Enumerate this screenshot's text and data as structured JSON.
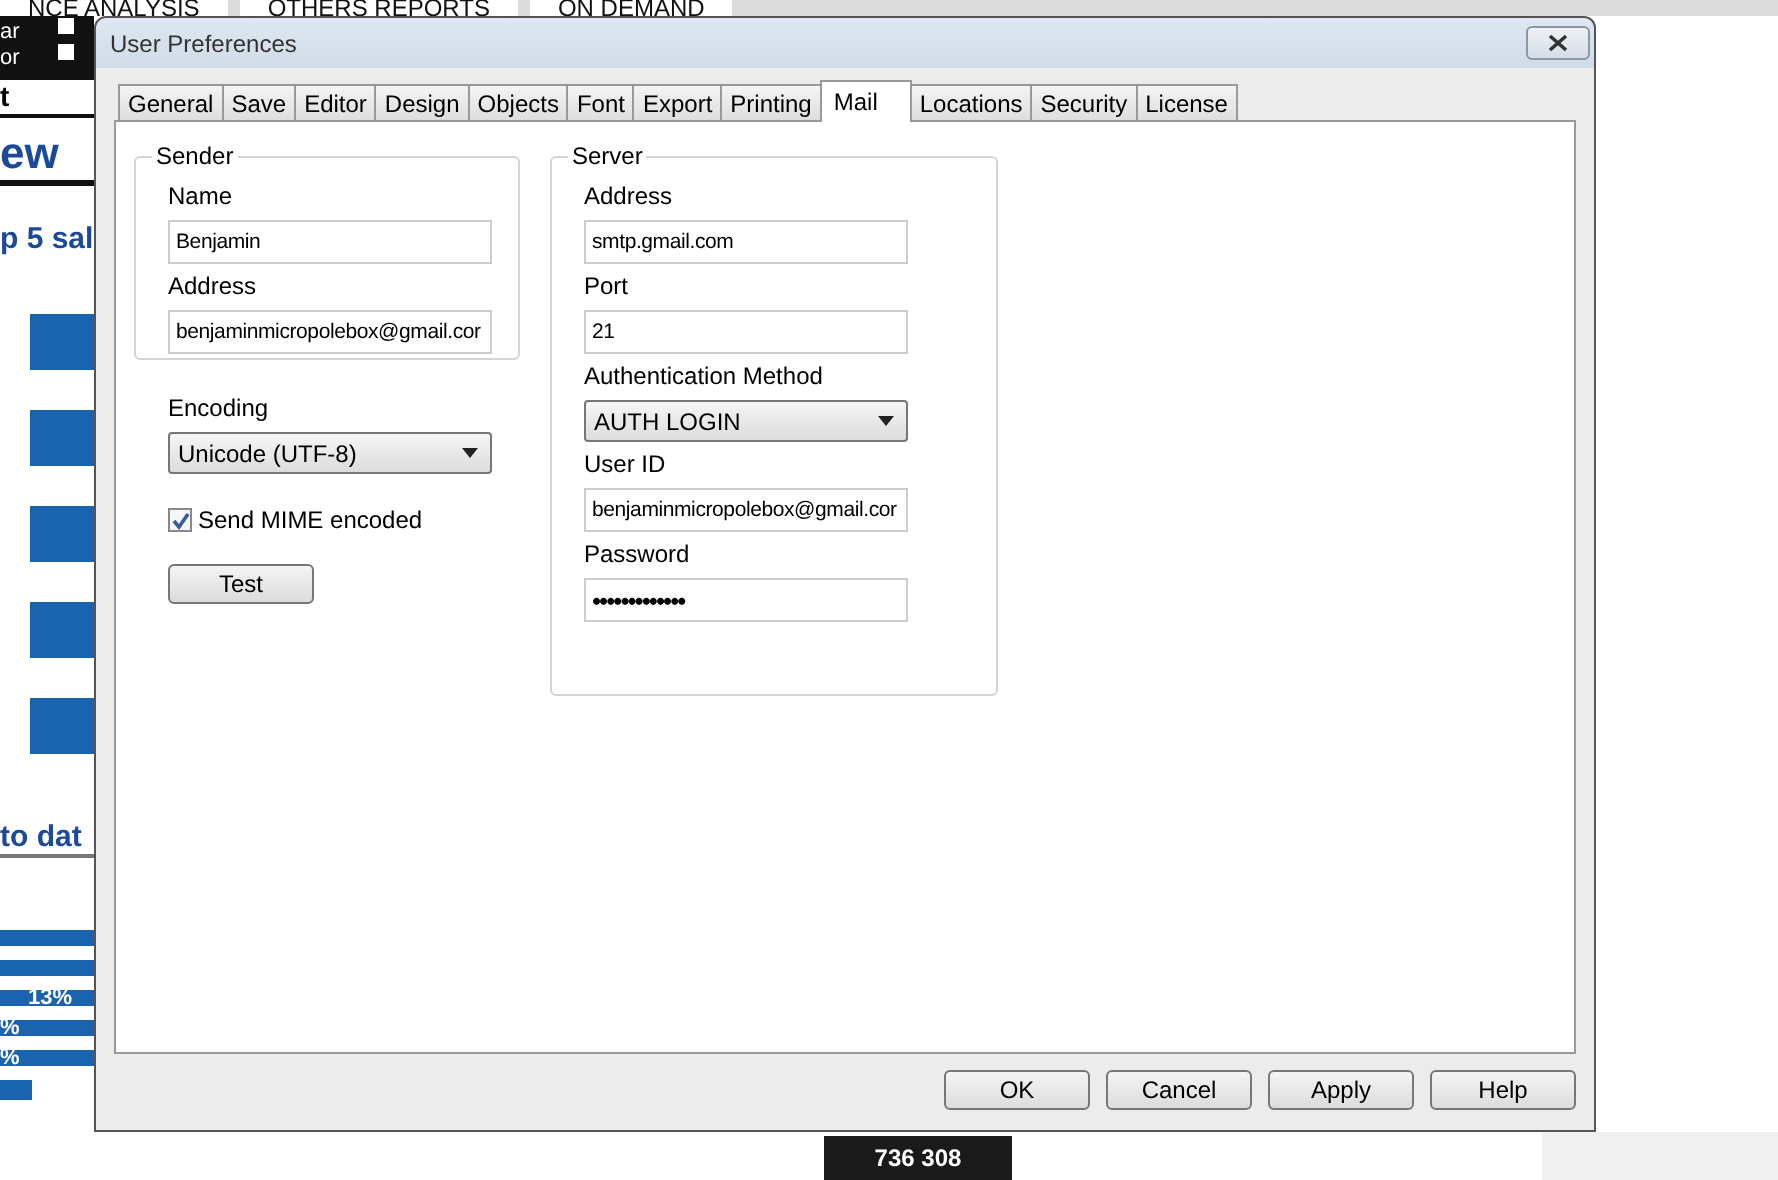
{
  "background": {
    "top_tabs": [
      {
        "label": "NCE ANALYSIS"
      },
      {
        "label": "OTHERS REPORTS"
      },
      {
        "label": "ON DEMAND"
      }
    ],
    "options": [
      "ar",
      "or"
    ],
    "checkboxes": [
      {
        "checked": false
      },
      {
        "checked": false
      }
    ],
    "dropdown": "t",
    "heading": "ew",
    "subheading": "p 5 sal",
    "section": "to dat",
    "bar_labels": [
      "13%",
      "%",
      "%"
    ],
    "total": "736 308"
  },
  "window": {
    "title": "User Preferences"
  },
  "tabs": [
    {
      "label": "General",
      "selected": false
    },
    {
      "label": "Save",
      "selected": false
    },
    {
      "label": "Editor",
      "selected": false
    },
    {
      "label": "Design",
      "selected": false
    },
    {
      "label": "Objects",
      "selected": false
    },
    {
      "label": "Font",
      "selected": false
    },
    {
      "label": "Export",
      "selected": false
    },
    {
      "label": "Printing",
      "selected": false
    },
    {
      "label": "Mail",
      "selected": true
    },
    {
      "label": "Locations",
      "selected": false
    },
    {
      "label": "Security",
      "selected": false
    },
    {
      "label": "License",
      "selected": false
    }
  ],
  "sender": {
    "title": "Sender",
    "fields": [
      {
        "kind": "text",
        "label": "Name",
        "value": "Benjamin"
      },
      {
        "kind": "text",
        "label": "Address",
        "value": "benjaminmicropolebox@gmail.cor"
      }
    ]
  },
  "encoding": {
    "label": "Encoding",
    "value": "Unicode (UTF-8)"
  },
  "send_mime": {
    "label": "Send MIME encoded",
    "checked": true
  },
  "test_button": "Test",
  "server": {
    "title": "Server",
    "fields": [
      {
        "kind": "text",
        "label": "Address",
        "value": "smtp.gmail.com"
      },
      {
        "kind": "text",
        "label": "Port",
        "value": "21"
      },
      {
        "kind": "dropdown",
        "label": "Authentication Method",
        "value": "AUTH LOGIN"
      },
      {
        "kind": "text",
        "label": "User ID",
        "value": "benjaminmicropolebox@gmail.cor"
      },
      {
        "kind": "password",
        "label": "Password",
        "value": "•••••••••••••"
      }
    ]
  },
  "buttons": [
    "OK",
    "Cancel",
    "Apply",
    "Help"
  ]
}
